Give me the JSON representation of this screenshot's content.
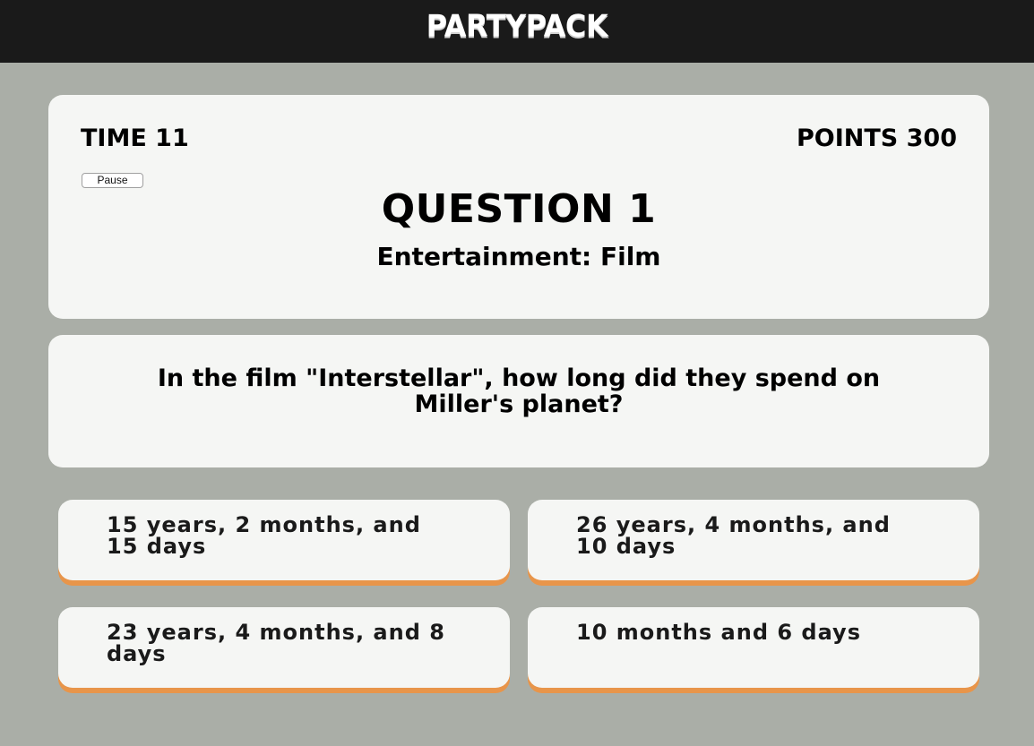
{
  "app": {
    "logo": "PARTYPACK"
  },
  "status": {
    "time_label": "TIME 11",
    "points_label": "POINTS 300",
    "pause_label": "Pause"
  },
  "question": {
    "number_label": "QUESTION 1",
    "category": "Entertainment: Film",
    "text": "In the film \"Interstellar\", how long did they spend on Miller's planet?"
  },
  "answers": [
    {
      "label": "15 years, 2 months, and 15 days"
    },
    {
      "label": "26 years, 4 months, and 10 days"
    },
    {
      "label": "23 years, 4 months, and 8 days"
    },
    {
      "label": "10 months and 6 days"
    }
  ],
  "colors": {
    "background": "#aaaea7",
    "topbar": "#1a1a1a",
    "card": "#f5f6f4",
    "answer_accent": "#e8954a"
  }
}
